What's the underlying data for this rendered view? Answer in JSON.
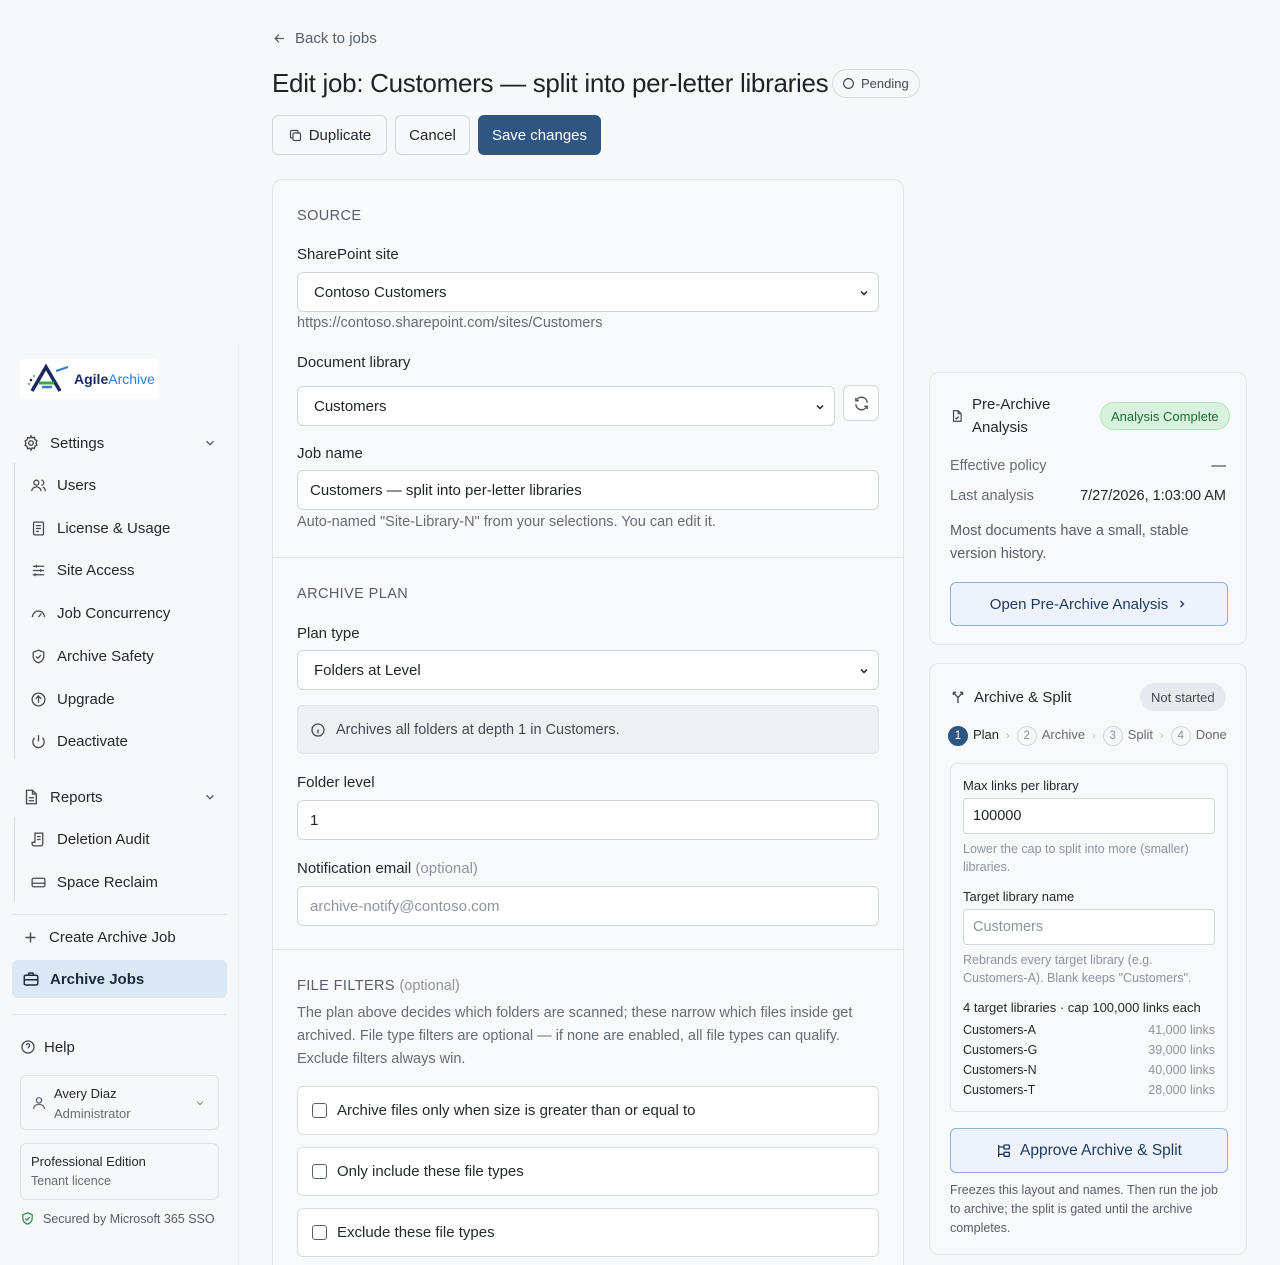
{
  "header": {
    "back_label": "Back to jobs",
    "title": "Edit job: Customers — split into per-letter libraries",
    "status": "Pending",
    "duplicate_label": "Duplicate",
    "cancel_label": "Cancel",
    "save_label": "Save changes"
  },
  "sidebar": {
    "logo": {
      "part1": "Agile",
      "part2": "Archive"
    },
    "settings_label": "Settings",
    "settings_items": [
      {
        "label": "Users",
        "icon": "users-icon"
      },
      {
        "label": "License & Usage",
        "icon": "license-icon"
      },
      {
        "label": "Site Access",
        "icon": "sliders-icon"
      },
      {
        "label": "Job Concurrency",
        "icon": "gauge-icon"
      },
      {
        "label": "Archive Safety",
        "icon": "shield-icon"
      },
      {
        "label": "Upgrade",
        "icon": "upgrade-icon"
      },
      {
        "label": "Deactivate",
        "icon": "power-icon"
      }
    ],
    "reports_label": "Reports",
    "reports_items": [
      {
        "label": "Deletion Audit",
        "icon": "audit-icon"
      },
      {
        "label": "Space Reclaim",
        "icon": "drive-icon"
      }
    ],
    "create_label": "Create Archive Job",
    "jobs_label": "Archive Jobs",
    "help_label": "Help",
    "user": {
      "name": "Avery Diaz",
      "role": "Administrator"
    },
    "edition": {
      "name": "Professional Edition",
      "licence": "Tenant licence"
    },
    "sso": "Secured by Microsoft 365 SSO"
  },
  "source": {
    "section_title": "SOURCE",
    "site_label": "SharePoint site",
    "site_value": "Contoso Customers",
    "site_url": "https://contoso.sharepoint.com/sites/Customers",
    "library_label": "Document library",
    "library_value": "Customers",
    "job_name_label": "Job name",
    "job_name_value": "Customers — split into per-letter libraries",
    "job_name_hint": "Auto-named \"Site-Library-N\" from your selections. You can edit it."
  },
  "plan": {
    "section_title": "ARCHIVE PLAN",
    "plan_type_label": "Plan type",
    "plan_type_value": "Folders at Level",
    "info": "Archives all folders at depth 1 in Customers.",
    "folder_level_label": "Folder level",
    "folder_level_value": "1",
    "email_label": "Notification email",
    "email_optional": "(optional)",
    "email_placeholder": "archive-notify@contoso.com"
  },
  "filters": {
    "section_title": "FILE FILTERS",
    "section_optional": "(optional)",
    "description": "The plan above decides which folders are scanned; these narrow which files inside get archived. File type filters are optional — if none are enabled, all file types can qualify. Exclude filters always win.",
    "size_label": "Archive files only when size is greater than or equal to",
    "include_label": "Only include these file types",
    "exclude_label": "Exclude these file types"
  },
  "analysis": {
    "title": "Pre-Archive Analysis",
    "badge": "Analysis Complete",
    "policy_label": "Effective policy",
    "policy_value": "—",
    "last_label": "Last analysis",
    "last_value": "7/27/2026, 1:03:00 AM",
    "summary": "Most documents have a small, stable version history.",
    "open_label": "Open Pre-Archive Analysis"
  },
  "split": {
    "title": "Archive & Split",
    "badge": "Not started",
    "steps": [
      {
        "n": "1",
        "label": "Plan"
      },
      {
        "n": "2",
        "label": "Archive"
      },
      {
        "n": "3",
        "label": "Split"
      },
      {
        "n": "4",
        "label": "Done"
      }
    ],
    "max_label": "Max links per library",
    "max_value": "100000",
    "max_hint": "Lower the cap to split into more (smaller) libraries.",
    "target_label": "Target library name",
    "target_placeholder": "Customers",
    "target_hint": "Rebrands every target library (e.g. Customers-A). Blank keeps \"Customers\".",
    "summary": "4 target libraries · cap 100,000 links each",
    "libraries": [
      {
        "name": "Customers-A",
        "count": "41,000 links"
      },
      {
        "name": "Customers-G",
        "count": "39,000 links"
      },
      {
        "name": "Customers-N",
        "count": "40,000 links"
      },
      {
        "name": "Customers-T",
        "count": "28,000 links"
      }
    ],
    "approve_label": "Approve Archive & Split",
    "footnote": "Freezes this layout and names. Then run the job to archive; the split is gated until the archive completes."
  }
}
